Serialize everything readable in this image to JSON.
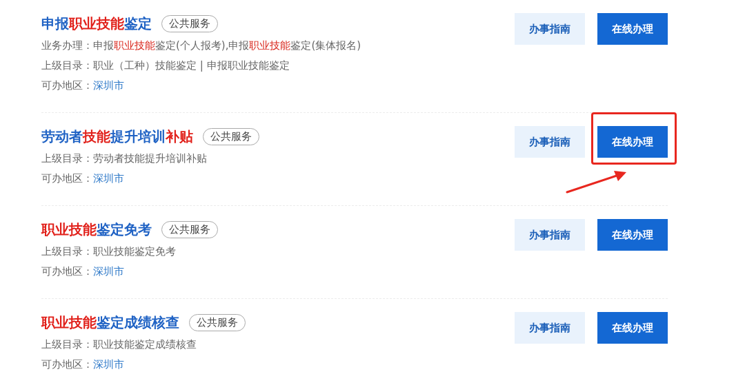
{
  "items": [
    {
      "title": [
        {
          "text": "申报",
          "highlight": false
        },
        {
          "text": "职业技能",
          "highlight": true
        },
        {
          "text": "鉴定",
          "highlight": false
        }
      ],
      "tag": "公共服务",
      "lines": [
        {
          "label": "业务办理：",
          "kind": "text",
          "parts": [
            {
              "text": "申报",
              "highlight": false
            },
            {
              "text": "职业技能",
              "highlight": true
            },
            {
              "text": "鉴定(个人报考),申报",
              "highlight": false
            },
            {
              "text": "职业技能",
              "highlight": true
            },
            {
              "text": "鉴定(集体报名)",
              "highlight": false
            }
          ]
        },
        {
          "label": "上级目录：",
          "kind": "text",
          "parts": [
            {
              "text": "职业（工种）技能鉴定 | 申报职业技能鉴定",
              "highlight": false
            }
          ]
        },
        {
          "label": "可办地区：",
          "kind": "link",
          "value": "深圳市"
        }
      ],
      "guide": "办事指南",
      "online": "在线办理",
      "annotated": false
    },
    {
      "title": [
        {
          "text": "劳动者",
          "highlight": false
        },
        {
          "text": "技能",
          "highlight": true
        },
        {
          "text": "提升培训",
          "highlight": false
        },
        {
          "text": "补贴",
          "highlight": true
        }
      ],
      "tag": "公共服务",
      "lines": [
        {
          "label": "上级目录：",
          "kind": "text",
          "parts": [
            {
              "text": "劳动者技能提升培训补贴",
              "highlight": false
            }
          ]
        },
        {
          "label": "可办地区：",
          "kind": "link",
          "value": "深圳市"
        }
      ],
      "guide": "办事指南",
      "online": "在线办理",
      "annotated": true
    },
    {
      "title": [
        {
          "text": "职业技能",
          "highlight": true
        },
        {
          "text": "鉴定免考",
          "highlight": false
        }
      ],
      "tag": "公共服务",
      "lines": [
        {
          "label": "上级目录：",
          "kind": "text",
          "parts": [
            {
              "text": "职业技能鉴定免考",
              "highlight": false
            }
          ]
        },
        {
          "label": "可办地区：",
          "kind": "link",
          "value": "深圳市"
        }
      ],
      "guide": "办事指南",
      "online": "在线办理",
      "annotated": false
    },
    {
      "title": [
        {
          "text": "职业技能",
          "highlight": true
        },
        {
          "text": "鉴定成绩核查",
          "highlight": false
        }
      ],
      "tag": "公共服务",
      "lines": [
        {
          "label": "上级目录：",
          "kind": "text",
          "parts": [
            {
              "text": "职业技能鉴定成绩核查",
              "highlight": false
            }
          ]
        },
        {
          "label": "可办地区：",
          "kind": "link",
          "value": "深圳市"
        }
      ],
      "guide": "办事指南",
      "online": "在线办理",
      "annotated": false
    }
  ]
}
